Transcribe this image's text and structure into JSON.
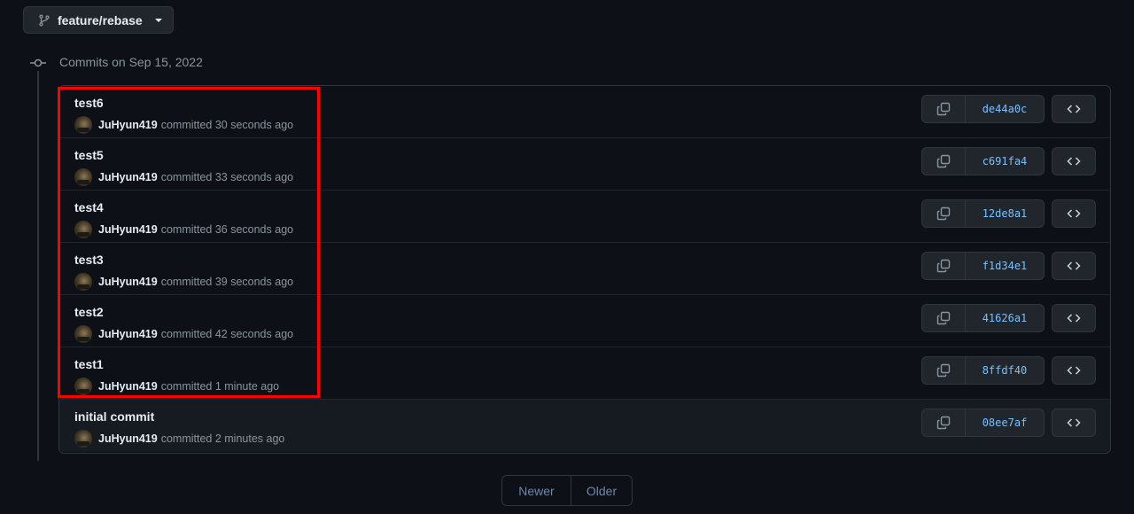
{
  "branch": {
    "name": "feature/rebase"
  },
  "timeline": {
    "date_label": "Commits on Sep 15, 2022"
  },
  "commits": [
    {
      "title": "test6",
      "author": "JuHyun419",
      "time": "committed 30 seconds ago",
      "sha": "de44a0c"
    },
    {
      "title": "test5",
      "author": "JuHyun419",
      "time": "committed 33 seconds ago",
      "sha": "c691fa4"
    },
    {
      "title": "test4",
      "author": "JuHyun419",
      "time": "committed 36 seconds ago",
      "sha": "12de8a1"
    },
    {
      "title": "test3",
      "author": "JuHyun419",
      "time": "committed 39 seconds ago",
      "sha": "f1d34e1"
    },
    {
      "title": "test2",
      "author": "JuHyun419",
      "time": "committed 42 seconds ago",
      "sha": "41626a1"
    },
    {
      "title": "test1",
      "author": "JuHyun419",
      "time": "committed 1 minute ago",
      "sha": "8ffdf40"
    },
    {
      "title": "initial commit",
      "author": "JuHyun419",
      "time": "committed 2 minutes ago",
      "sha": "08ee7af"
    }
  ],
  "pagination": {
    "newer": "Newer",
    "older": "Older"
  },
  "colors": {
    "background": "#0d1117",
    "sha_link": "#79c0ff",
    "highlight": "#ff0000"
  }
}
